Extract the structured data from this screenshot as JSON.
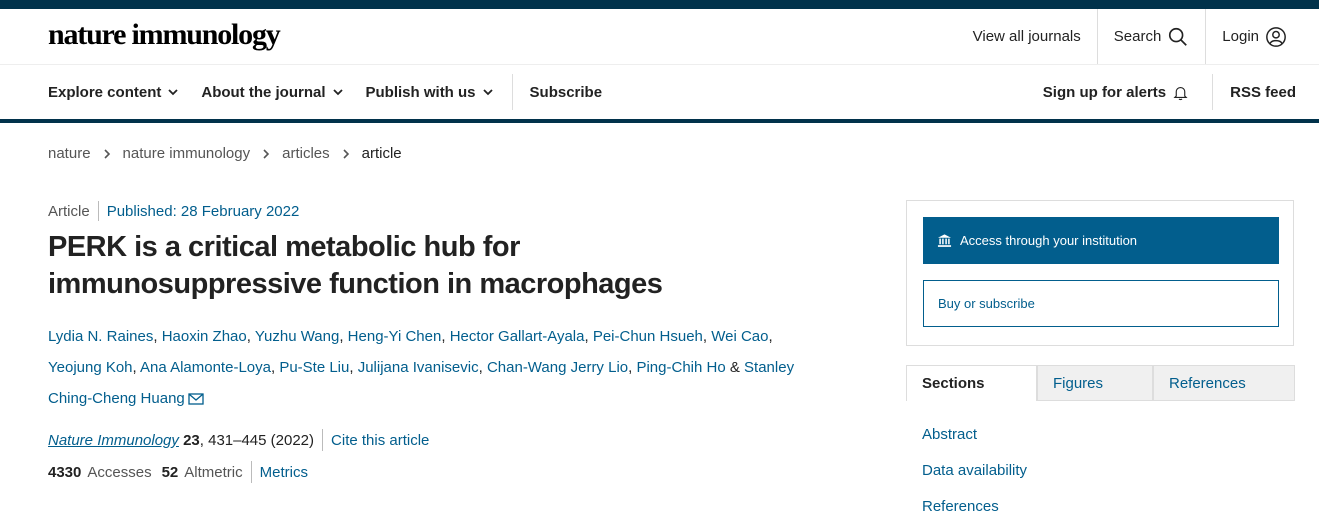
{
  "header": {
    "logo": "nature immunology",
    "view_all_journals": "View all journals",
    "search": "Search",
    "login": "Login"
  },
  "nav": {
    "explore": "Explore content",
    "about": "About the journal",
    "publish": "Publish with us",
    "subscribe": "Subscribe",
    "alerts": "Sign up for alerts",
    "rss": "RSS feed"
  },
  "breadcrumb": [
    "nature",
    "nature immunology",
    "articles",
    "article"
  ],
  "article": {
    "type": "Article",
    "published": "Published: 28 February 2022",
    "title": "PERK is a critical metabolic hub for immunosuppressive function in macrophages",
    "authors": [
      "Lydia N. Raines",
      "Haoxin Zhao",
      "Yuzhu Wang",
      "Heng-Yi Chen",
      "Hector Gallart-Ayala",
      "Pei-Chun Hsueh",
      "Wei Cao",
      "Yeojung Koh",
      "Ana Alamonte-Loya",
      "Pu-Ste Liu",
      "Julijana Ivanisevic",
      "Chan-Wang Jerry Lio",
      "Ping-Chih Ho",
      "Stanley Ching-Cheng Huang"
    ],
    "author_sep": ", ",
    "author_and": " & ",
    "journal": "Nature Immunology",
    "volume": "23",
    "pages": ", 431–445 (2022)",
    "cite": "Cite this article",
    "accesses_value": "4330",
    "accesses_label": "Accesses",
    "altmetric_value": "52",
    "altmetric_label": "Altmetric",
    "metrics_link": "Metrics"
  },
  "access": {
    "institution_button": "Access through your institution",
    "buy_button": "Buy or subscribe"
  },
  "tabs": [
    "Sections",
    "Figures",
    "References"
  ],
  "sections": [
    "Abstract",
    "Data availability",
    "References"
  ],
  "colors": {
    "brand_dark": "#01324b",
    "link": "#025e8d"
  }
}
